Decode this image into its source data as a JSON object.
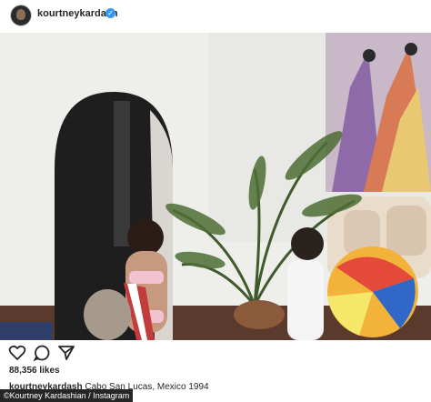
{
  "post": {
    "username": "kourtneykardash",
    "verified_glyph": "✓",
    "likes": "88,356 likes",
    "caption_user": "kourtneykardash",
    "caption_text": "Cabo San Lucas, Mexico 1994"
  },
  "credit": "©Kourtney Kardashian / Instagram",
  "icons": [
    "avatar",
    "verified-badge-icon",
    "heart-icon",
    "comment-icon",
    "share-icon"
  ],
  "colors": {
    "verified": "#3897f0",
    "text": "#262626"
  }
}
